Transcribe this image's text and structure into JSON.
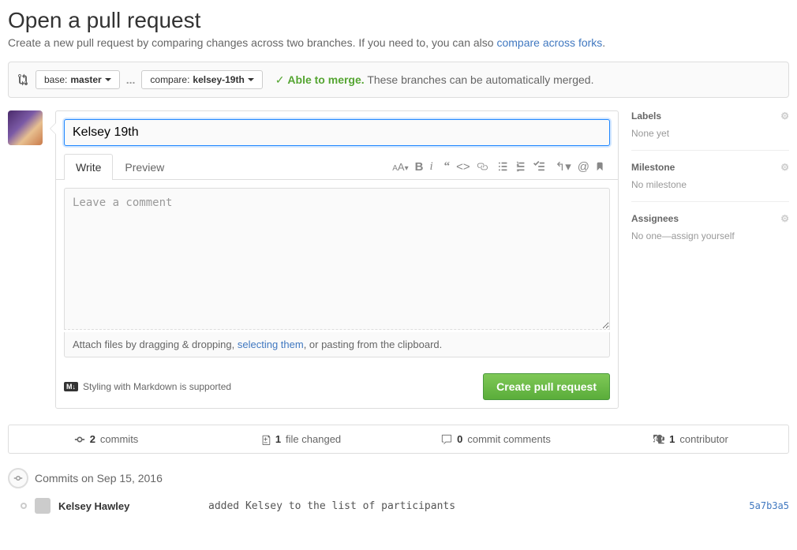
{
  "page": {
    "title": "Open a pull request",
    "subtitle_pre": "Create a new pull request by comparing changes across two branches. If you need to, you can also ",
    "subtitle_link": "compare across forks",
    "subtitle_post": "."
  },
  "compare": {
    "base_label": "base: ",
    "base_value": "master",
    "compare_label": "compare: ",
    "compare_value": "kelsey-19th",
    "dots": "..."
  },
  "merge": {
    "status": "Able to merge.",
    "message": "These branches can be automatically merged."
  },
  "form": {
    "title_value": "Kelsey 19th",
    "tab_write": "Write",
    "tab_preview": "Preview",
    "placeholder": "Leave a comment",
    "attach_pre": "Attach files by dragging & dropping, ",
    "attach_link": "selecting them",
    "attach_post": ", or pasting from the clipboard.",
    "md_support": "Styling with Markdown is supported",
    "submit": "Create pull request"
  },
  "sidebar": {
    "labels": {
      "title": "Labels",
      "value": "None yet"
    },
    "milestone": {
      "title": "Milestone",
      "value": "No milestone"
    },
    "assignees": {
      "title": "Assignees",
      "value": "No one—assign yourself"
    }
  },
  "stats": {
    "commits_count": "2",
    "commits_label": "commits",
    "files_count": "1",
    "files_label": "file changed",
    "comments_count": "0",
    "comments_label": "commit comments",
    "contributors_count": "1",
    "contributors_label": "contributor"
  },
  "commits": {
    "date_header": "Commits on Sep 15, 2016",
    "row": {
      "author": "Kelsey Hawley",
      "message": "added Kelsey to the list of participants",
      "hash": "5a7b3a5"
    }
  }
}
